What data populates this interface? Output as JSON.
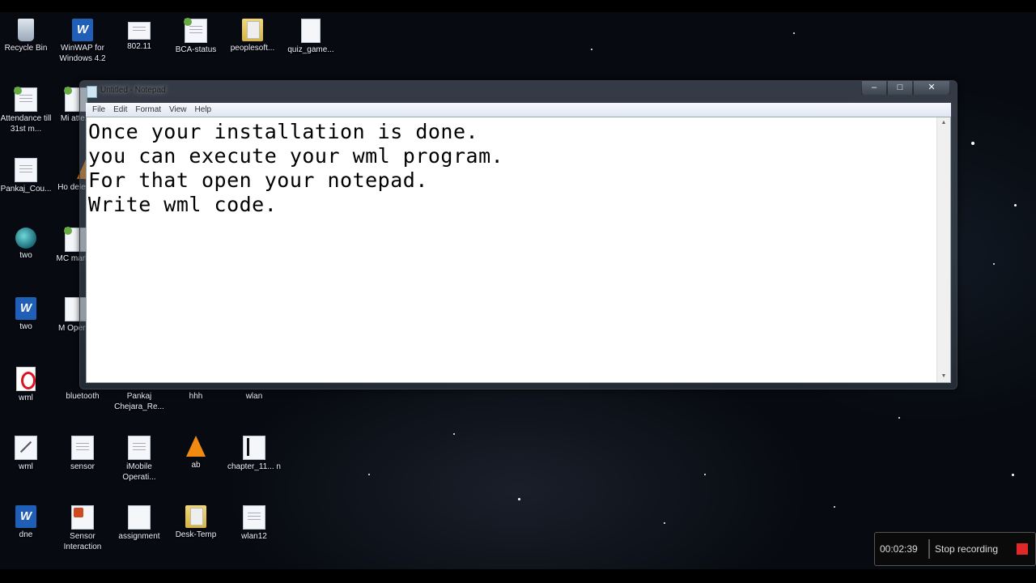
{
  "desktop": {
    "icons": [
      {
        "label": "Recycle Bin",
        "type": "recycle"
      },
      {
        "label": "WinWAP for Windows 4.2",
        "type": "word"
      },
      {
        "label": "802.11",
        "type": "doc"
      },
      {
        "label": "BCA-status",
        "type": "doc-green"
      },
      {
        "label": "peoplesoft...",
        "type": "folder"
      },
      {
        "label": "quiz_game...",
        "type": "doc"
      },
      {
        "label": "Attendance till 31st m...",
        "type": "doc-green"
      },
      {
        "label": "Mi atte...",
        "type": "doc-green"
      },
      {
        "label": "Pankaj_Cou...",
        "type": "doc"
      },
      {
        "label": "Ho delet...",
        "type": "vlc"
      },
      {
        "label": "two",
        "type": "globe"
      },
      {
        "label": "MC mark...",
        "type": "doc-green"
      },
      {
        "label": "two",
        "type": "word"
      },
      {
        "label": "M Operi...",
        "type": "doc"
      },
      {
        "label": "wml",
        "type": "opera"
      },
      {
        "label": "bluetooth",
        "type": "doc"
      },
      {
        "label": "Pankaj Chejara_Re...",
        "type": "doc"
      },
      {
        "label": "hhh",
        "type": "doc"
      },
      {
        "label": "wlan",
        "type": "doc"
      },
      {
        "label": "wml",
        "type": "doc"
      },
      {
        "label": "sensor",
        "type": "doc"
      },
      {
        "label": "iMobile Operati...",
        "type": "doc"
      },
      {
        "label": "ab",
        "type": "vlc"
      },
      {
        "label": "chapter_11... n",
        "type": "doc"
      },
      {
        "label": "dne",
        "type": "word"
      },
      {
        "label": "Sensor Interaction",
        "type": "ppt"
      },
      {
        "label": "assignment",
        "type": "doc"
      },
      {
        "label": "Desk-Temp",
        "type": "folder"
      },
      {
        "label": "wlan12",
        "type": "doc"
      }
    ]
  },
  "notepad": {
    "title": "Untitled - Notepad",
    "menu": [
      "File",
      "Edit",
      "Format",
      "View",
      "Help"
    ],
    "controls": {
      "minimize": "–",
      "maximize": "□",
      "close": "✕"
    },
    "content": "Once your installation is done.\nyou can execute your wml program.\nFor that open your notepad.\nWrite wml code.",
    "scroll_up": "▲",
    "scroll_down": "▼"
  },
  "recorder": {
    "elapsed": "00:02:39",
    "stop_label": "Stop recording",
    "stop_color": "#e02828"
  }
}
